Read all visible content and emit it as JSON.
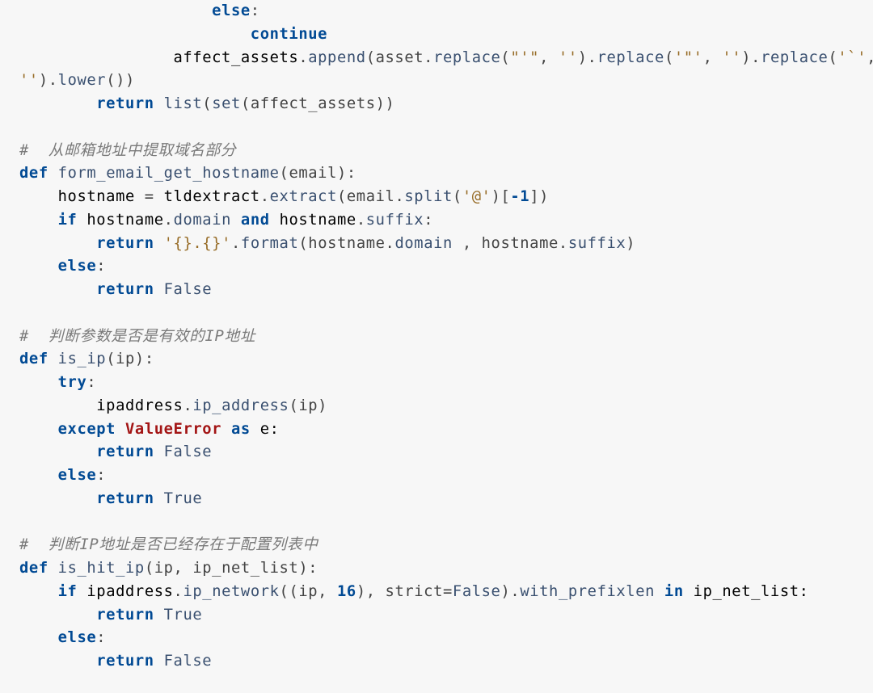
{
  "code": {
    "line01a": "else",
    "line01b": ":",
    "line02a": "continue",
    "line03_txt1": "                affect_assets",
    "line03_append": "append",
    "line03_asset": "(asset",
    "line03_replace": "replace",
    "line03_s1": "\"'\"",
    "line03_s2": "''",
    "line03_s3": "'\"'",
    "line03_s4": "''",
    "line03_s5": "'`'",
    "line04_s6": "''",
    "line04_lower": "lower",
    "line04_end": "())",
    "line05_return": "return",
    "line05_list": "list",
    "line05_set": "set",
    "line05_arg": "(affect_assets))",
    "cmt1": "#  从邮箱地址中提取域名部分",
    "fn1_def": "def",
    "fn1_name": "form_email_get_hostname",
    "fn1_sig": "(email):",
    "fn1_l1a": "    hostname ",
    "fn1_l1eq": "=",
    "fn1_l1tld": " tldextract",
    "fn1_extract": "extract",
    "fn1_l1mid": "(email",
    "fn1_split": "split",
    "fn1_at": "'@'",
    "fn1_idx_open": ")[",
    "fn1_idx_neg1": "-1",
    "fn1_idx_close": "])",
    "fn1_if": "if",
    "fn1_ifcond1": " hostname",
    "fn1_domain": "domain ",
    "fn1_and": "and",
    "fn1_ifcond2": " hostname",
    "fn1_suffix": "suffix",
    "fn1_colon": ":",
    "fn1_ret1": "return",
    "fn1_fmtstr": "'{}.{}'",
    "fn1_format": "format",
    "fn1_fmtargs1": "(hostname",
    "fn1_fmtargs2": ", hostname",
    "fn1_else": "else",
    "fn1_ret2": "return",
    "fn1_false": "False",
    "cmt2": "#  判断参数是否是有效的IP地址",
    "fn2_def": "def",
    "fn2_name": "is_ip",
    "fn2_sig": "(ip):",
    "fn2_try": "try",
    "fn2_ipaddr": "        ipaddress",
    "fn2_ipfn": "ip_address",
    "fn2_iparg": "(ip)",
    "fn2_except": "except",
    "fn2_valerr": "ValueError",
    "fn2_as": "as",
    "fn2_e": " e:",
    "fn2_ret1": "return",
    "fn2_false": "False",
    "fn2_else": "else",
    "fn2_ret2": "return",
    "fn2_true": "True",
    "cmt3": "#  判断IP地址是否已经存在于配置列表中",
    "fn3_def": "def",
    "fn3_name": "is_hit_ip",
    "fn3_sig": "(ip, ip_net_list):",
    "fn3_if": "if",
    "fn3_ipaddr": " ipaddress",
    "fn3_ipnet": "ip_network",
    "fn3_open": "((ip, ",
    "fn3_16": "16",
    "fn3_strict": "), strict",
    "fn3_eq": "=",
    "fn3_false": "False",
    "fn3_close": ")",
    "fn3_prefix": "with_prefixlen ",
    "fn3_in": "in",
    "fn3_list": " ip_net_list:",
    "fn3_ret1": "return",
    "fn3_true1": "True",
    "fn3_else": "else",
    "fn3_ret2": "return",
    "fn3_false2": "False"
  }
}
